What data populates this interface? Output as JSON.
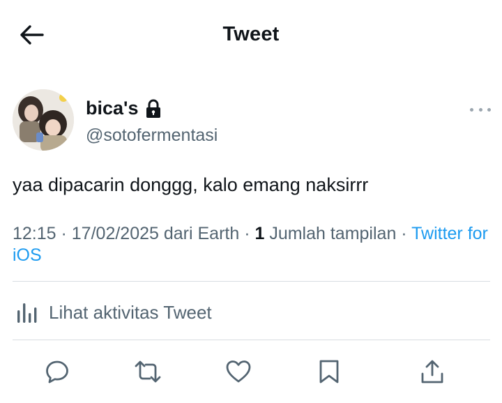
{
  "header": {
    "title": "Tweet",
    "back_icon": "arrow-left-icon"
  },
  "author": {
    "display_name": "bica's",
    "handle": "@sotofermentasi",
    "protected_icon": "lock-icon",
    "more_icon": "more-horizontal-icon"
  },
  "tweet": {
    "text": "yaa dipacarin donggg, kalo emang naksirrr"
  },
  "meta": {
    "time": "12:15",
    "separator": " · ",
    "date": "17/02/2025",
    "location": " dari Earth",
    "views_count": "1",
    "views_label": " Jumlah tampilan",
    "source": "Twitter for iOS"
  },
  "activity": {
    "label": "Lihat aktivitas Tweet",
    "icon": "analytics-icon"
  },
  "actions": {
    "reply_icon": "reply-icon",
    "retweet_icon": "retweet-icon",
    "like_icon": "heart-icon",
    "bookmark_icon": "bookmark-icon",
    "share_icon": "share-icon"
  },
  "colors": {
    "text": "#0f1419",
    "secondary": "#536471",
    "link": "#1d9bf0",
    "divider": "#d8dde1",
    "icon": "#536471"
  }
}
